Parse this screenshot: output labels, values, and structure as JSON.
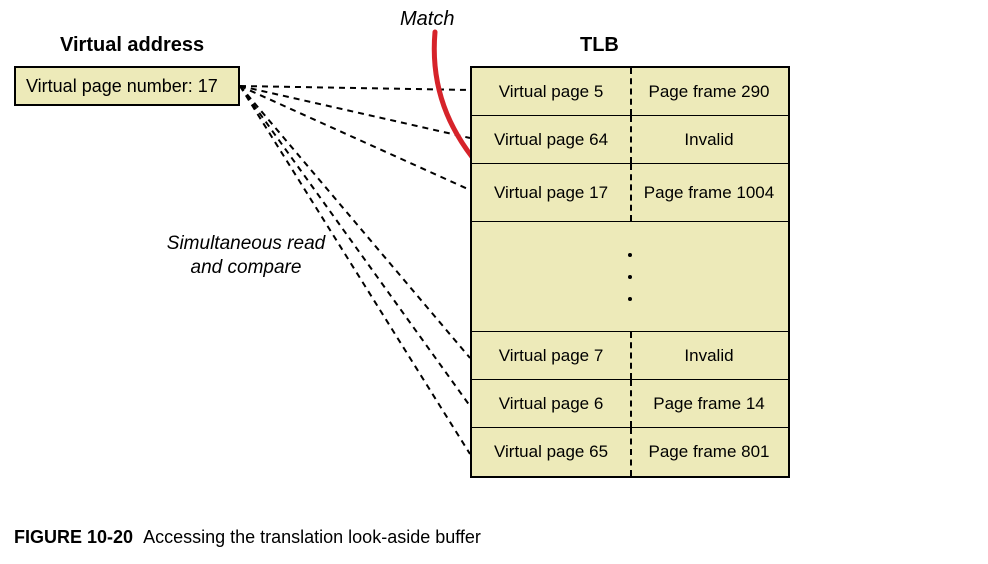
{
  "virtual_address": {
    "heading": "Virtual address",
    "box_text": "Virtual page number: 17"
  },
  "tlb": {
    "heading": "TLB",
    "rows": [
      {
        "left": "Virtual page 5",
        "right": "Page frame 290"
      },
      {
        "left": "Virtual page 64",
        "right": "Invalid"
      },
      {
        "left": "Virtual page 17",
        "right": "Page frame 1004"
      },
      {
        "left": "Virtual page 7",
        "right": "Invalid"
      },
      {
        "left": "Virtual page 6",
        "right": "Page frame 14"
      },
      {
        "left": "Virtual page 65",
        "right": "Page frame 801"
      }
    ]
  },
  "labels": {
    "match": "Match",
    "simultaneous_line1": "Simultaneous read",
    "simultaneous_line2": "and compare"
  },
  "caption": {
    "figure_number": "FIGURE 10-20",
    "text": "Accessing the translation look-aside buffer"
  },
  "highlight": {
    "color": "#d6232a",
    "target_row_index": 2
  }
}
